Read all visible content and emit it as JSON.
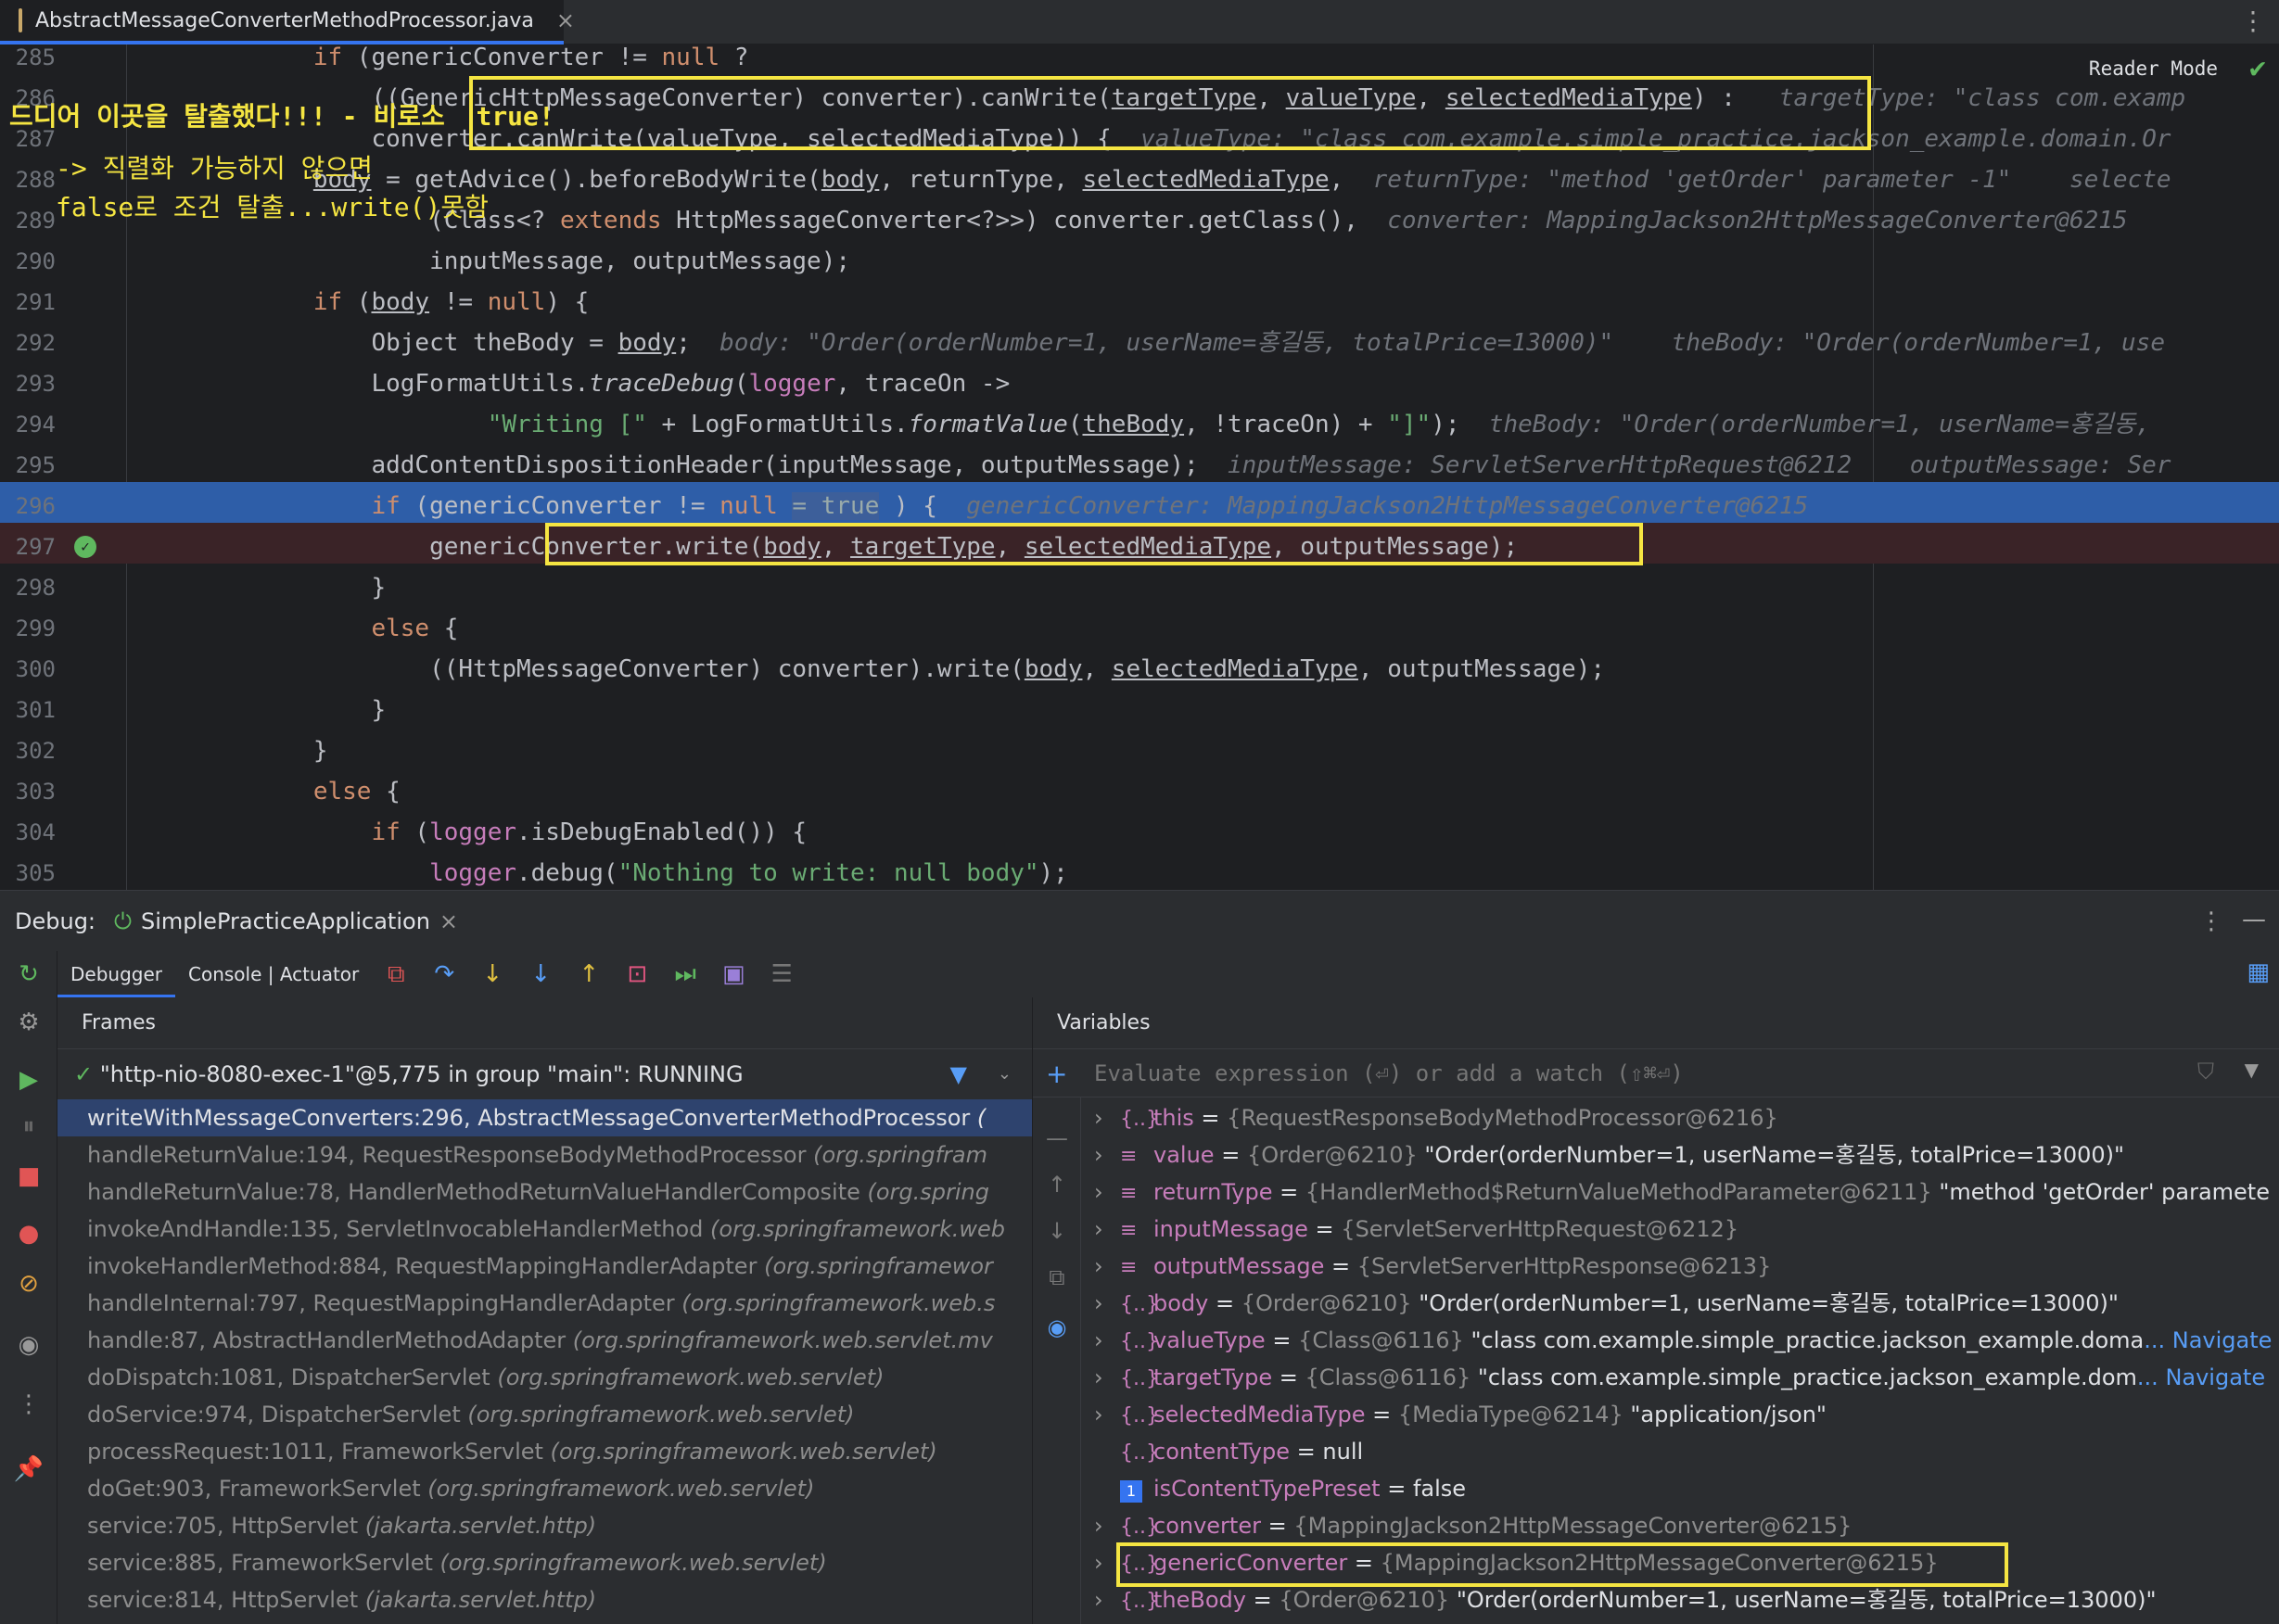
{
  "tab": {
    "filename": "AbstractMessageConverterMethodProcessor.java",
    "close": "×"
  },
  "editor": {
    "reader_mode": "Reader Mode",
    "lines": [
      {
        "num": "285"
      },
      {
        "num": "286"
      },
      {
        "num": "287"
      },
      {
        "num": "288"
      },
      {
        "num": "289"
      },
      {
        "num": "290"
      },
      {
        "num": "291"
      },
      {
        "num": "292"
      },
      {
        "num": "293"
      },
      {
        "num": "294"
      },
      {
        "num": "295"
      },
      {
        "num": "296"
      },
      {
        "num": "297"
      },
      {
        "num": "298"
      },
      {
        "num": "299"
      },
      {
        "num": "300"
      },
      {
        "num": "301"
      },
      {
        "num": "302"
      },
      {
        "num": "303"
      },
      {
        "num": "304"
      },
      {
        "num": "305"
      }
    ],
    "annotations": {
      "top": "드디어 이곳을 탈출했다!!! - 비로소  true!",
      "line1": "-> 직렬화 가능하지 않으면",
      "line2": "false로 조건 탈출...write()못함"
    },
    "inline_true": "= true"
  },
  "debug": {
    "label": "Debug:",
    "session": "SimplePracticeApplication",
    "tabs": [
      "Debugger",
      "Console | Actuator"
    ]
  },
  "frames": {
    "title": "Frames",
    "thread": "\"http-nio-8080-exec-1\"@5,775 in group \"main\": RUNNING",
    "items": [
      {
        "method": "writeWithMessageConverters:296, AbstractMessageConverterMethodProcessor",
        "pkg": "(",
        "selected": true
      },
      {
        "method": "handleReturnValue:194, RequestResponseBodyMethodProcessor",
        "pkg": "(org.springfram"
      },
      {
        "method": "handleReturnValue:78, HandlerMethodReturnValueHandlerComposite",
        "pkg": "(org.spring"
      },
      {
        "method": "invokeAndHandle:135, ServletInvocableHandlerMethod",
        "pkg": "(org.springframework.web"
      },
      {
        "method": "invokeHandlerMethod:884, RequestMappingHandlerAdapter",
        "pkg": "(org.springframewor"
      },
      {
        "method": "handleInternal:797, RequestMappingHandlerAdapter",
        "pkg": "(org.springframework.web.s"
      },
      {
        "method": "handle:87, AbstractHandlerMethodAdapter",
        "pkg": "(org.springframework.web.servlet.mv"
      },
      {
        "method": "doDispatch:1081, DispatcherServlet",
        "pkg": "(org.springframework.web.servlet)"
      },
      {
        "method": "doService:974, DispatcherServlet",
        "pkg": "(org.springframework.web.servlet)"
      },
      {
        "method": "processRequest:1011, FrameworkServlet",
        "pkg": "(org.springframework.web.servlet)"
      },
      {
        "method": "doGet:903, FrameworkServlet",
        "pkg": "(org.springframework.web.servlet)"
      },
      {
        "method": "service:705, HttpServlet",
        "pkg": "(jakarta.servlet.http)"
      },
      {
        "method": "service:885, FrameworkServlet",
        "pkg": "(org.springframework.web.servlet)"
      },
      {
        "method": "service:814, HttpServlet",
        "pkg": "(jakarta.servlet.http)"
      }
    ]
  },
  "variables": {
    "title": "Variables",
    "eval_placeholder": "Evaluate expression (⏎) or add a watch (⇧⌘⏎)",
    "items": [
      {
        "name": "this",
        "ref": "{RequestResponseBodyMethodProcessor@6216}",
        "value": "",
        "icon": "{..}",
        "expand": true
      },
      {
        "name": "value",
        "ref": "{Order@6210}",
        "value": "\"Order(orderNumber=1, userName=홍길동, totalPrice=13000)\"",
        "icon": "≡",
        "expand": true
      },
      {
        "name": "returnType",
        "ref": "{HandlerMethod$ReturnValueMethodParameter@6211}",
        "value": "\"method 'getOrder' paramete",
        "icon": "≡",
        "expand": true
      },
      {
        "name": "inputMessage",
        "ref": "{ServletServerHttpRequest@6212}",
        "value": "",
        "icon": "≡",
        "expand": true
      },
      {
        "name": "outputMessage",
        "ref": "{ServletServerHttpResponse@6213}",
        "value": "",
        "icon": "≡",
        "expand": true
      },
      {
        "name": "body",
        "ref": "{Order@6210}",
        "value": "\"Order(orderNumber=1, userName=홍길동, totalPrice=13000)\"",
        "icon": "{..}",
        "expand": true
      },
      {
        "name": "valueType",
        "ref": "{Class@6116}",
        "value": "\"class com.example.simple_practice.jackson_example.doma",
        "icon": "{..}",
        "expand": true,
        "nav": "... Navigate"
      },
      {
        "name": "targetType",
        "ref": "{Class@6116}",
        "value": "\"class com.example.simple_practice.jackson_example.dom",
        "icon": "{..}",
        "expand": true,
        "nav": "... Navigate"
      },
      {
        "name": "selectedMediaType",
        "ref": "{MediaType@6214}",
        "value": "\"application/json\"",
        "icon": "{..}",
        "expand": true
      },
      {
        "name": "contentType",
        "ref": "",
        "value": "null",
        "icon": "{..}",
        "expand": false
      },
      {
        "name": "isContentTypePreset",
        "ref": "",
        "value": "false",
        "icon": "1",
        "expand": false
      },
      {
        "name": "converter",
        "ref": "{MappingJackson2HttpMessageConverter@6215}",
        "value": "",
        "icon": "{..}",
        "expand": true
      },
      {
        "name": "genericConverter",
        "ref": "{MappingJackson2HttpMessageConverter@6215}",
        "value": "",
        "icon": "{..}",
        "expand": true
      },
      {
        "name": "theBody",
        "ref": "{Order@6210}",
        "value": "\"Order(orderNumber=1, userName=홍길동, totalPrice=13000)\"",
        "icon": "{..}",
        "expand": true
      }
    ]
  },
  "colors": {
    "highlight_box": "#f5e542",
    "exec_line": "#2e5ea8",
    "accent": "#3574f0"
  }
}
